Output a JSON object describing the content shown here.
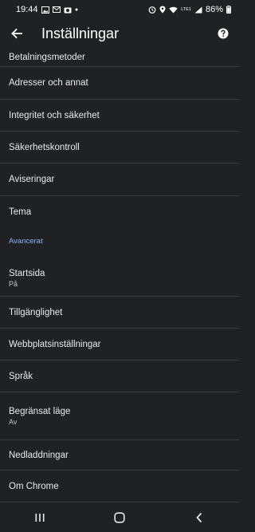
{
  "status_bar": {
    "time": "19:44",
    "network_label": "LTE1",
    "battery_percent": "86%"
  },
  "app_bar": {
    "title": "Inställningar"
  },
  "settings": {
    "items": [
      {
        "label": "Betalningsmetoder"
      },
      {
        "label": "Adresser och annat"
      },
      {
        "label": "Integritet och säkerhet"
      },
      {
        "label": "Säkerhetskontroll"
      },
      {
        "label": "Aviseringar"
      },
      {
        "label": "Tema"
      }
    ],
    "section_advanced": "Avancerat",
    "advanced_items": [
      {
        "label": "Startsida",
        "value": "På"
      },
      {
        "label": "Tillgänglighet"
      },
      {
        "label": "Webbplatsinställningar"
      },
      {
        "label": "Språk"
      },
      {
        "label": "Begränsat läge",
        "value": "Av"
      },
      {
        "label": "Nedladdningar"
      },
      {
        "label": "Om Chrome"
      }
    ]
  },
  "icons": {
    "back": "arrow-back-icon",
    "help": "help-icon",
    "recents": "recents-icon",
    "home": "home-icon",
    "nav_back": "nav-back-icon"
  }
}
